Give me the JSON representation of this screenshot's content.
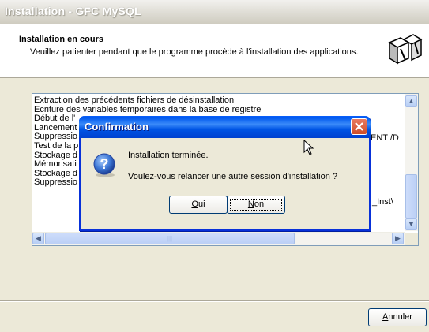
{
  "window": {
    "title": "Installation - GFC MySQL",
    "header_title": "Installation en cours",
    "header_subtitle": "Veuillez patienter pendant que le programme procède à l'installation des applications."
  },
  "log": {
    "lines": [
      "Extraction des précédents fichiers de désinstallation",
      "Ecriture des variables temporaires dans la base de registre",
      "Début de l'",
      "Lancement",
      "Suppressio",
      "Test de la p",
      "Stockage d",
      "Mémorisati",
      "Stockage d",
      "Suppressio"
    ],
    "line3_right": "ENT /D",
    "line10_right": "_Inst\\"
  },
  "buttons": {
    "cancel_pre": "",
    "cancel_hot": "A",
    "cancel_post": "nnuler"
  },
  "dialog": {
    "title": "Confirmation",
    "message1": "Installation terminée.",
    "message2": "Voulez-vous relancer une autre session d'installation ?",
    "yes_hot": "O",
    "yes_post": "ui",
    "no_hot": "N",
    "no_post": "on"
  },
  "colors": {
    "dialog_title": "#0055e5",
    "close_button": "#d04e29",
    "window_bg": "#ece9d8"
  },
  "icons": {
    "header": "setup-boxes-icon",
    "dialog": "question-icon",
    "cursor": "mouse-pointer-icon"
  }
}
